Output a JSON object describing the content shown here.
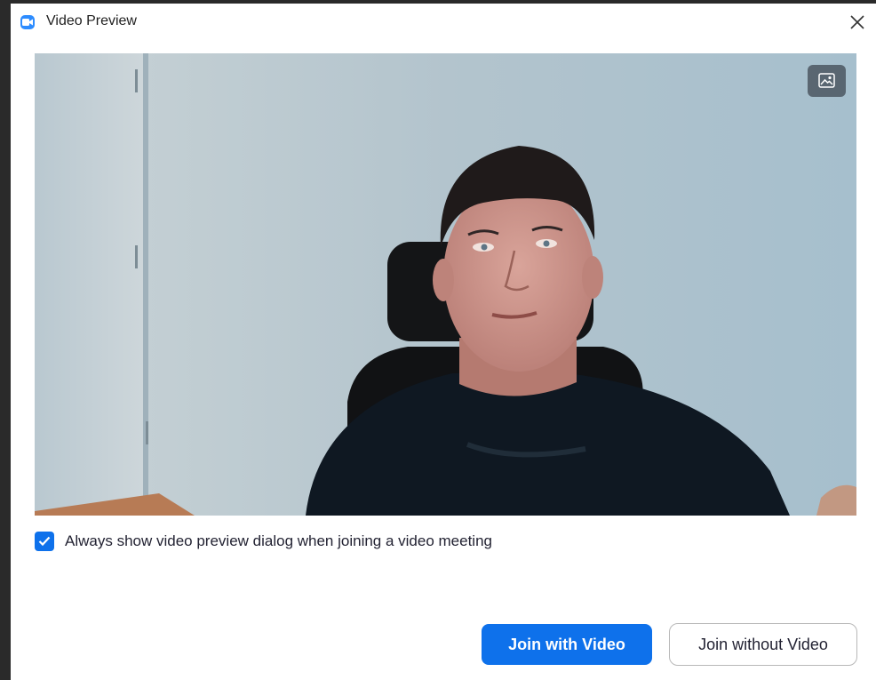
{
  "window": {
    "title": "Video Preview",
    "app_icon": "zoom-camera-icon",
    "close_icon": "close-icon"
  },
  "preview": {
    "background_button_icon": "image-background-icon"
  },
  "options": {
    "always_show_preview_label": "Always show video preview dialog when joining a video meeting",
    "always_show_preview_checked": true
  },
  "actions": {
    "join_with_video_label": "Join with Video",
    "join_without_video_label": "Join without Video"
  },
  "colors": {
    "accent": "#0e71eb",
    "app_icon": "#2d8cff"
  }
}
